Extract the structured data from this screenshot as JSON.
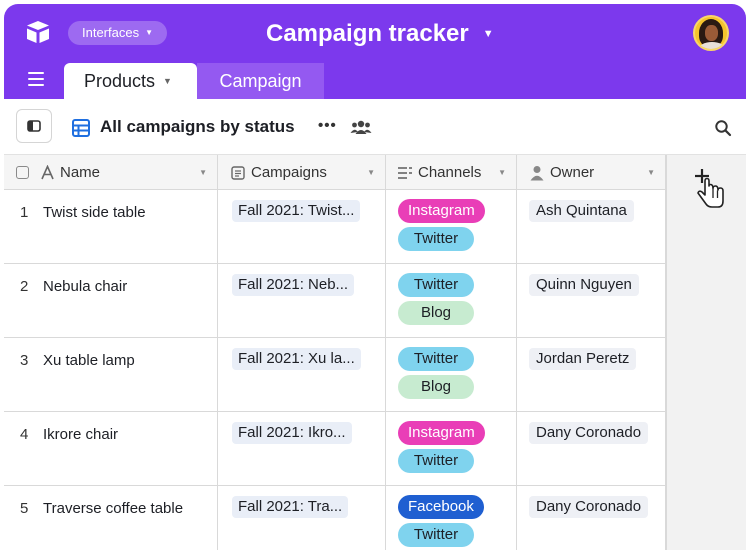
{
  "app": {
    "interfaces_label": "Interfaces",
    "base_title": "Campaign tracker",
    "colors": {
      "brand": "#7c39ed",
      "tab_inactive": "#9459f1"
    }
  },
  "tabs": [
    {
      "label": "Products",
      "active": true
    },
    {
      "label": "Campaign",
      "active": false
    }
  ],
  "view": {
    "name": "All campaigns by status",
    "more_label": "•••"
  },
  "columns": [
    {
      "label": "Name",
      "icon": "text-a-icon"
    },
    {
      "label": "Campaigns",
      "icon": "linked-record-icon"
    },
    {
      "label": "Channels",
      "icon": "multi-select-icon"
    },
    {
      "label": "Owner",
      "icon": "user-icon"
    }
  ],
  "rows": [
    {
      "num": "1",
      "name": "Twist side table",
      "campaign": "Fall 2021: Twist...",
      "channels": [
        "Instagram",
        "Twitter"
      ],
      "owner": "Ash Quintana"
    },
    {
      "num": "2",
      "name": "Nebula chair",
      "campaign": "Fall 2021: Neb...",
      "channels": [
        "Twitter",
        "Blog"
      ],
      "owner": "Quinn Nguyen"
    },
    {
      "num": "3",
      "name": "Xu table lamp",
      "campaign": "Fall 2021: Xu la...",
      "channels": [
        "Twitter",
        "Blog"
      ],
      "owner": "Jordan Peretz"
    },
    {
      "num": "4",
      "name": "Ikrore chair",
      "campaign": "Fall 2021: Ikro...",
      "channels": [
        "Instagram",
        "Twitter"
      ],
      "owner": "Dany Coronado"
    },
    {
      "num": "5",
      "name": "Traverse coffee table",
      "campaign": "Fall 2021: Tra...",
      "channels": [
        "Facebook",
        "Twitter"
      ],
      "owner": "Dany Coronado"
    }
  ],
  "channel_colors": {
    "Instagram": {
      "bg": "#e93eb7",
      "fg": "#ffffff"
    },
    "Twitter": {
      "bg": "#7fd3ee",
      "fg": "#1d1f25"
    },
    "Blog": {
      "bg": "#c7ebd0",
      "fg": "#1d1f25"
    },
    "Facebook": {
      "bg": "#1f5fd1",
      "fg": "#ffffff"
    }
  }
}
